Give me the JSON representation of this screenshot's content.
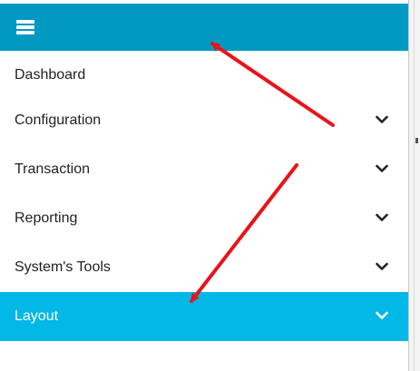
{
  "menu": {
    "items": [
      {
        "label": "Dashboard",
        "has_children": false
      },
      {
        "label": "Configuration",
        "has_children": true
      },
      {
        "label": "Transaction",
        "has_children": true
      },
      {
        "label": "Reporting",
        "has_children": true
      },
      {
        "label": "System's Tools",
        "has_children": true
      },
      {
        "label": "Layout",
        "has_children": true,
        "active": true
      }
    ]
  },
  "colors": {
    "topbar": "#0199c2",
    "active_item": "#02b8e6",
    "arrow": "#e8141b"
  },
  "icons": {
    "menu_toggle": "hamburger-icon",
    "expand": "chevron-down-icon",
    "annotation": "red-arrow"
  }
}
